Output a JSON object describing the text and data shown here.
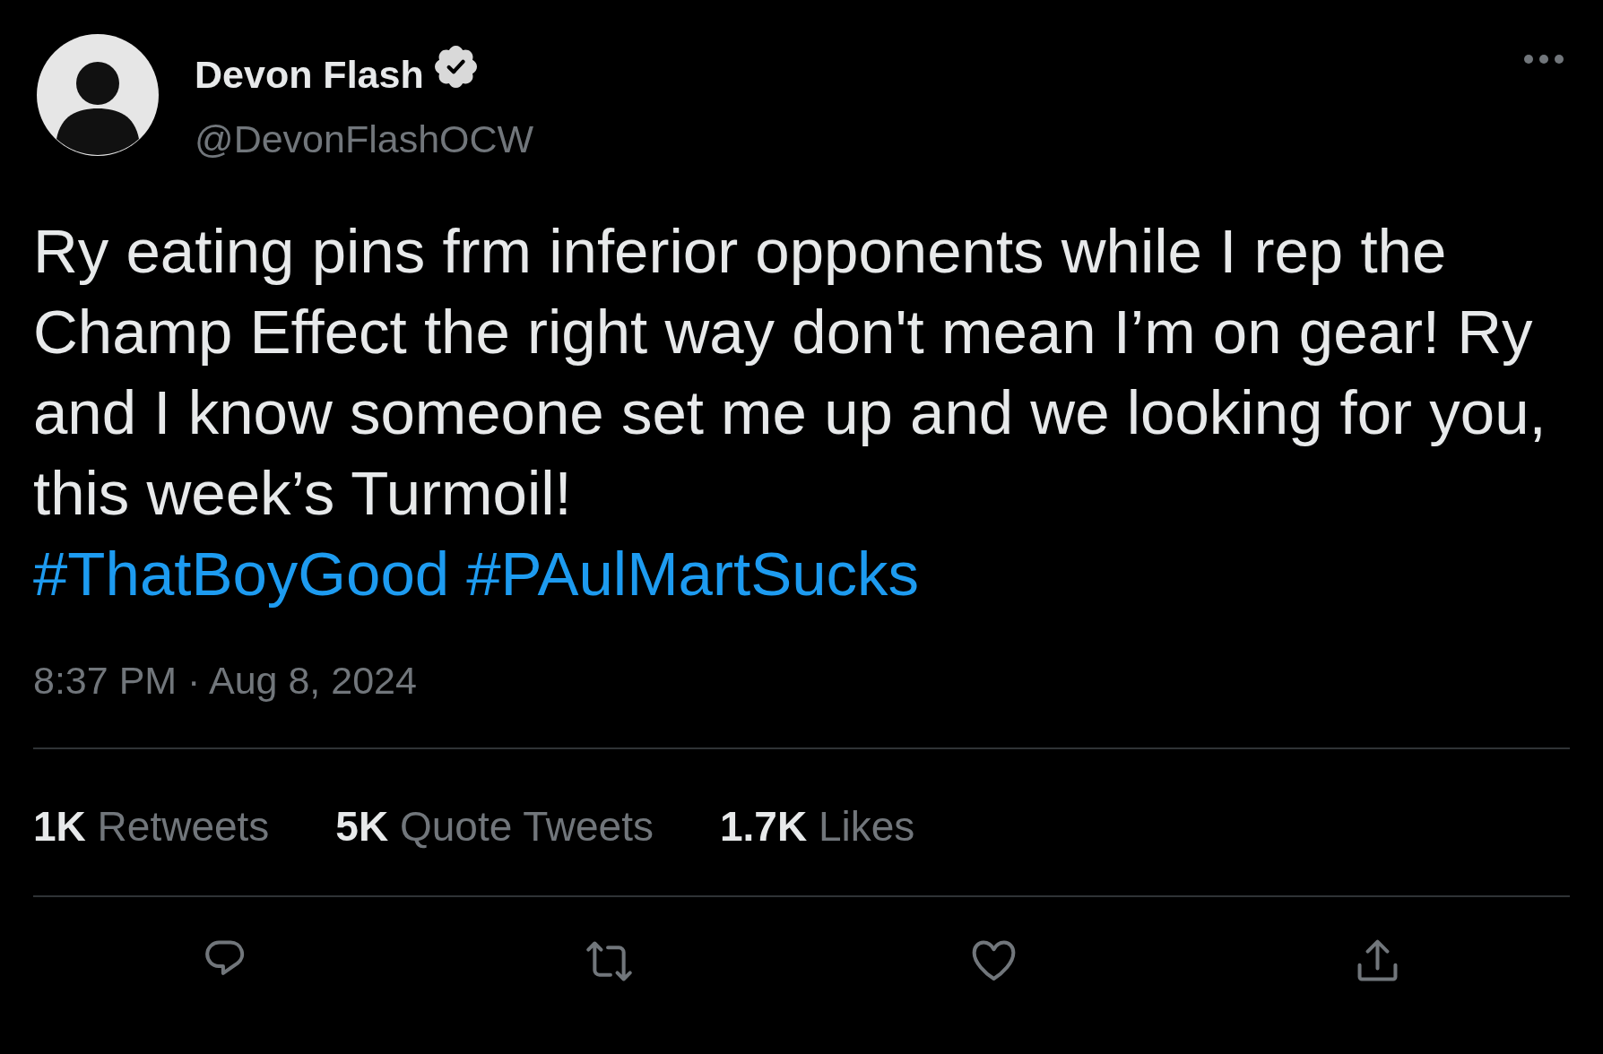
{
  "author": {
    "name": "Devon Flash",
    "verified": true,
    "handle": "@DevonFlashOCW"
  },
  "tweet": {
    "text": "Ry eating pins frm inferior opponents while I rep the Champ Effect the right way don't mean I’m on gear! Ry and I know someone set me up and we looking for you, this week’s Turmoil!",
    "hashtags": [
      "#ThatBoyGood",
      "#PAulMartSucks"
    ],
    "timestamp": "8:37 PM · Aug 8, 2024"
  },
  "stats": [
    {
      "count": "1K",
      "label": "Retweets"
    },
    {
      "count": "5K",
      "label": "Quote Tweets"
    },
    {
      "count": "1.7K",
      "label": "Likes"
    }
  ],
  "actions": [
    {
      "kind": "reply"
    },
    {
      "kind": "retweet"
    },
    {
      "kind": "like"
    },
    {
      "kind": "share"
    }
  ]
}
